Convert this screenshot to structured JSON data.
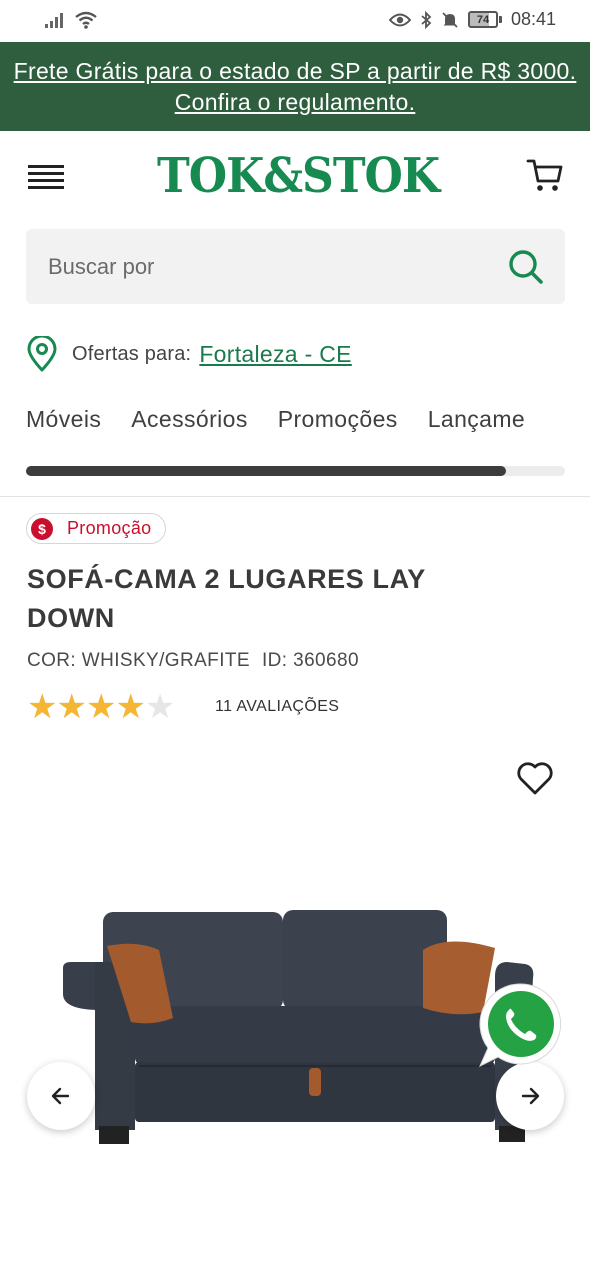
{
  "status_bar": {
    "time": "08:41",
    "battery": "74"
  },
  "promo_banner": {
    "text": "Frete Grátis para o estado de SP a partir de R$ 3000. Confira o regulamento."
  },
  "header": {
    "logo_text": "TOK&STOK"
  },
  "search": {
    "placeholder": "Buscar por",
    "value": ""
  },
  "location": {
    "prefix": "Ofertas para:",
    "city": "Fortaleza - CE"
  },
  "categories": [
    "Móveis",
    "Acessórios",
    "Promoções",
    "Lançame"
  ],
  "category_scroll_fraction": 0.89,
  "product": {
    "badge": "Promoção",
    "title": "SOFÁ-CAMA 2 LUGARES LAY DOWN",
    "color": "COR: WHISKY/GRAFITE",
    "id": "ID: 360680",
    "rating": 3.5,
    "rating_max": 5,
    "reviews": "11 AVALIAÇÕES"
  },
  "colors": {
    "brand_green": "#178a52",
    "banner_green": "#2f5e3f",
    "promo_red": "#c8102e",
    "star_yellow": "#f4b633",
    "whatsapp_green": "#25a244"
  }
}
